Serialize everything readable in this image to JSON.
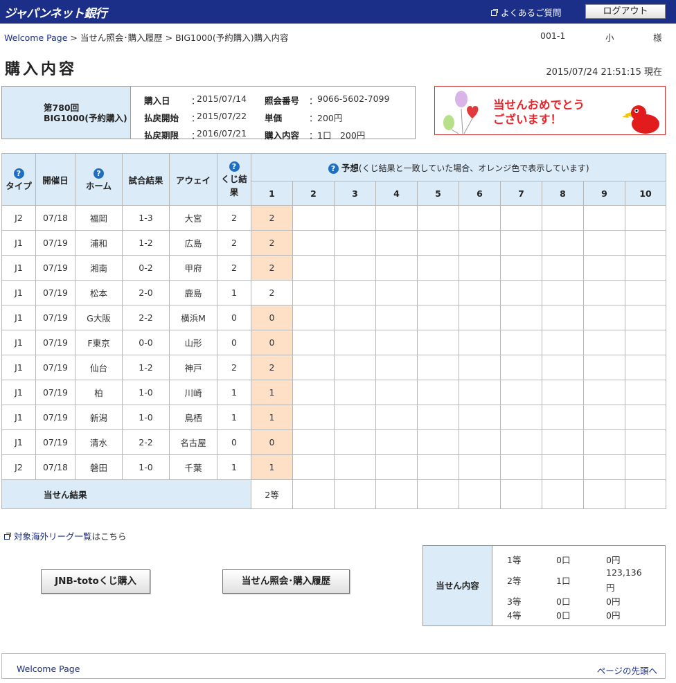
{
  "header": {
    "logo": "ジャパンネット銀行",
    "faq": "よくあるご質問",
    "logout": "ログアウト"
  },
  "breadcrumb": {
    "home": "Welcome Page",
    "sep1": ">",
    "history": "当せん照会･購入履歴",
    "sep2": ">",
    "current": "BIG1000(予約購入)購入内容"
  },
  "account": {
    "number": "001-1",
    "name": "小",
    "honorific": "様"
  },
  "page": {
    "title": "購入内容",
    "timestamp": "2015/07/24 21:51:15 現在"
  },
  "purchase": {
    "round": "第780回",
    "product": "BIG1000(予約購入)",
    "purchase_date_label": "購入日",
    "purchase_date": "2015/07/14",
    "payout_start_label": "払戻開始",
    "payout_start": "2015/07/22",
    "payout_deadline_label": "払戻期限",
    "payout_deadline": "2016/07/21",
    "ref_label": "照会番号",
    "ref_number": "9066-5602-7099",
    "unit_label": "単価",
    "unit_price": "200円",
    "content_label": "購入内容",
    "content": "1口　200円",
    "colon": "："
  },
  "banner": {
    "line1": "当せんおめでとう",
    "line2": "ございます！"
  },
  "table": {
    "headers": {
      "type": "タイプ",
      "date": "開催日",
      "home": "ホーム",
      "score": "試合結果",
      "away": "アウェイ",
      "kuji": "くじ結果",
      "yoso": "予想",
      "yoso_note": "(くじ結果と一致していた場合、オレンジ色で表示しています)",
      "help": "?"
    },
    "columns": [
      "1",
      "2",
      "3",
      "4",
      "5",
      "6",
      "7",
      "8",
      "9",
      "10"
    ],
    "rows": [
      {
        "type": "J2",
        "date": "07/18",
        "home": "福岡",
        "score": "1-3",
        "away": "大宮",
        "kuji": "2",
        "pick": "2",
        "match": true
      },
      {
        "type": "J1",
        "date": "07/19",
        "home": "浦和",
        "score": "1-2",
        "away": "広島",
        "kuji": "2",
        "pick": "2",
        "match": true
      },
      {
        "type": "J1",
        "date": "07/19",
        "home": "湘南",
        "score": "0-2",
        "away": "甲府",
        "kuji": "2",
        "pick": "2",
        "match": true
      },
      {
        "type": "J1",
        "date": "07/19",
        "home": "松本",
        "score": "2-0",
        "away": "鹿島",
        "kuji": "1",
        "pick": "2",
        "match": false
      },
      {
        "type": "J1",
        "date": "07/19",
        "home": "G大阪",
        "score": "2-2",
        "away": "横浜M",
        "kuji": "0",
        "pick": "0",
        "match": true
      },
      {
        "type": "J1",
        "date": "07/19",
        "home": "F東京",
        "score": "0-0",
        "away": "山形",
        "kuji": "0",
        "pick": "0",
        "match": true
      },
      {
        "type": "J1",
        "date": "07/19",
        "home": "仙台",
        "score": "1-2",
        "away": "神戸",
        "kuji": "2",
        "pick": "2",
        "match": true
      },
      {
        "type": "J1",
        "date": "07/19",
        "home": "柏",
        "score": "1-0",
        "away": "川崎",
        "kuji": "1",
        "pick": "1",
        "match": true
      },
      {
        "type": "J1",
        "date": "07/19",
        "home": "新潟",
        "score": "1-0",
        "away": "鳥栖",
        "kuji": "1",
        "pick": "1",
        "match": true
      },
      {
        "type": "J1",
        "date": "07/19",
        "home": "清水",
        "score": "2-2",
        "away": "名古屋",
        "kuji": "0",
        "pick": "0",
        "match": true
      },
      {
        "type": "J2",
        "date": "07/18",
        "home": "磐田",
        "score": "1-0",
        "away": "千葉",
        "kuji": "1",
        "pick": "1",
        "match": true
      }
    ],
    "result_label": "当せん結果",
    "result_value": "2等"
  },
  "links": {
    "league_link": "対象海外リーグ一覧",
    "league_suffix": "はこちら"
  },
  "buttons": {
    "buy": "JNB-totoくじ購入",
    "history": "当せん照会･購入履歴"
  },
  "winnings": {
    "label": "当せん内容",
    "rows": [
      {
        "grade": "1等",
        "count": "0口",
        "amount": "0円"
      },
      {
        "grade": "2等",
        "count": "1口",
        "amount_line1": "123,136",
        "amount_line2": "円"
      },
      {
        "grade": "3等",
        "count": "0口",
        "amount": "0円"
      },
      {
        "grade": "4等",
        "count": "0口",
        "amount": "0円"
      }
    ]
  },
  "footer": {
    "home": "Welcome Page",
    "top": "ページの先頭へ"
  },
  "colors": {
    "brand_navy": "#1c2f88",
    "header_blue": "#dcebf8",
    "match_orange": "#fde0c6",
    "prize_red": "#c00000",
    "banner_red": "#e8242c"
  }
}
